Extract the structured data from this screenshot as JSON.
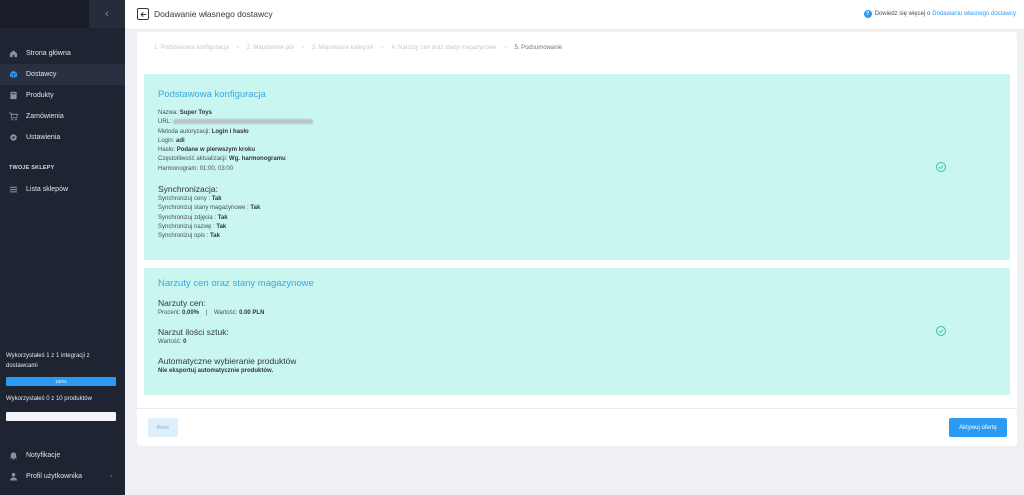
{
  "sidebar": {
    "collapse_icon": "chevron-left-icon",
    "nav": [
      {
        "label": "Strona główna",
        "icon": "home-icon"
      },
      {
        "label": "Dostawcy",
        "icon": "cube-icon",
        "active": true
      },
      {
        "label": "Produkty",
        "icon": "box-icon"
      },
      {
        "label": "Zamówienia",
        "icon": "cart-icon"
      },
      {
        "label": "Ustawienia",
        "icon": "gear-icon"
      }
    ],
    "section_title": "TWOJE SKLEPY",
    "shops_item": "Lista sklepów",
    "usage_integrations": "Wykorzystałeś 1 z 1 integracji z dostawcami",
    "usage_integrations_progress": "100%",
    "usage_products": "Wykorzystałeś 0 z 10 produktów",
    "usage_products_progress": 0,
    "notifications": "Notyfikacje",
    "profile": "Profil użytkownika"
  },
  "header": {
    "title": "Dodawanie własnego dostawcy",
    "help_text": "Dowiedz się więcej o",
    "help_link": "Dodawaniu własnego dostawcy"
  },
  "steps": [
    "1. Podstawowa konfiguracja",
    "2. Mapowanie pól",
    "3. Mapowanie kategorii",
    "4. Narzuty cen oraz stany magazynowe",
    "5. Podsumowanie"
  ],
  "summary": {
    "basic": {
      "title": "Podstawowa konfiguracja",
      "name_label": "Nazwa:",
      "name_value": "Super Toys",
      "url_label": "URL:",
      "auth_label": "Metoda autoryzacji:",
      "auth_value": "Login i hasło",
      "login_label": "Login:",
      "login_value": "adi",
      "password_label": "Hasło:",
      "password_value": "Podane w pierwszym kroku",
      "freq_label": "Częstotliwość aktualizacji:",
      "freq_value": "Wg. harmonogramu",
      "schedule_label": "Harmonogram:",
      "schedule_value": "01:00, 03:00"
    },
    "sync": {
      "title": "Synchronizacja:",
      "prices_label": "Synchronizuj ceny :",
      "prices_value": "Tak",
      "stock_label": "Synchronizuj stany magazynowe :",
      "stock_value": "Tak",
      "images_label": "Synchronizuj zdjęcia :",
      "images_value": "Tak",
      "name_label": "Synchronizuj nazwę :",
      "name_value": "Tak",
      "desc_label": "Synchronizuj opis :",
      "desc_value": "Tak"
    },
    "markup": {
      "title": "Narzuty cen oraz stany magazynowe",
      "price_title": "Narzuty cen:",
      "percent_label": "Procent:",
      "percent_value": "0.00%",
      "sep": "|",
      "amount_label": "Wartość:",
      "amount_value": "0.00 PLN",
      "qty_title": "Narzut ilości sztuk:",
      "qty_label": "Wartość:",
      "qty_value": "0",
      "auto_title": "Automatyczne wybieranie produktów",
      "auto_value": "Nie eksportuj automatycznie produktów."
    }
  },
  "buttons": {
    "back": "Wróć",
    "activate": "Aktywuj ofertę"
  },
  "colors": {
    "accent": "#2b9af3",
    "panel": "#c9f6ef",
    "sidebar": "#1f2433",
    "check": "#3cbfa8"
  }
}
